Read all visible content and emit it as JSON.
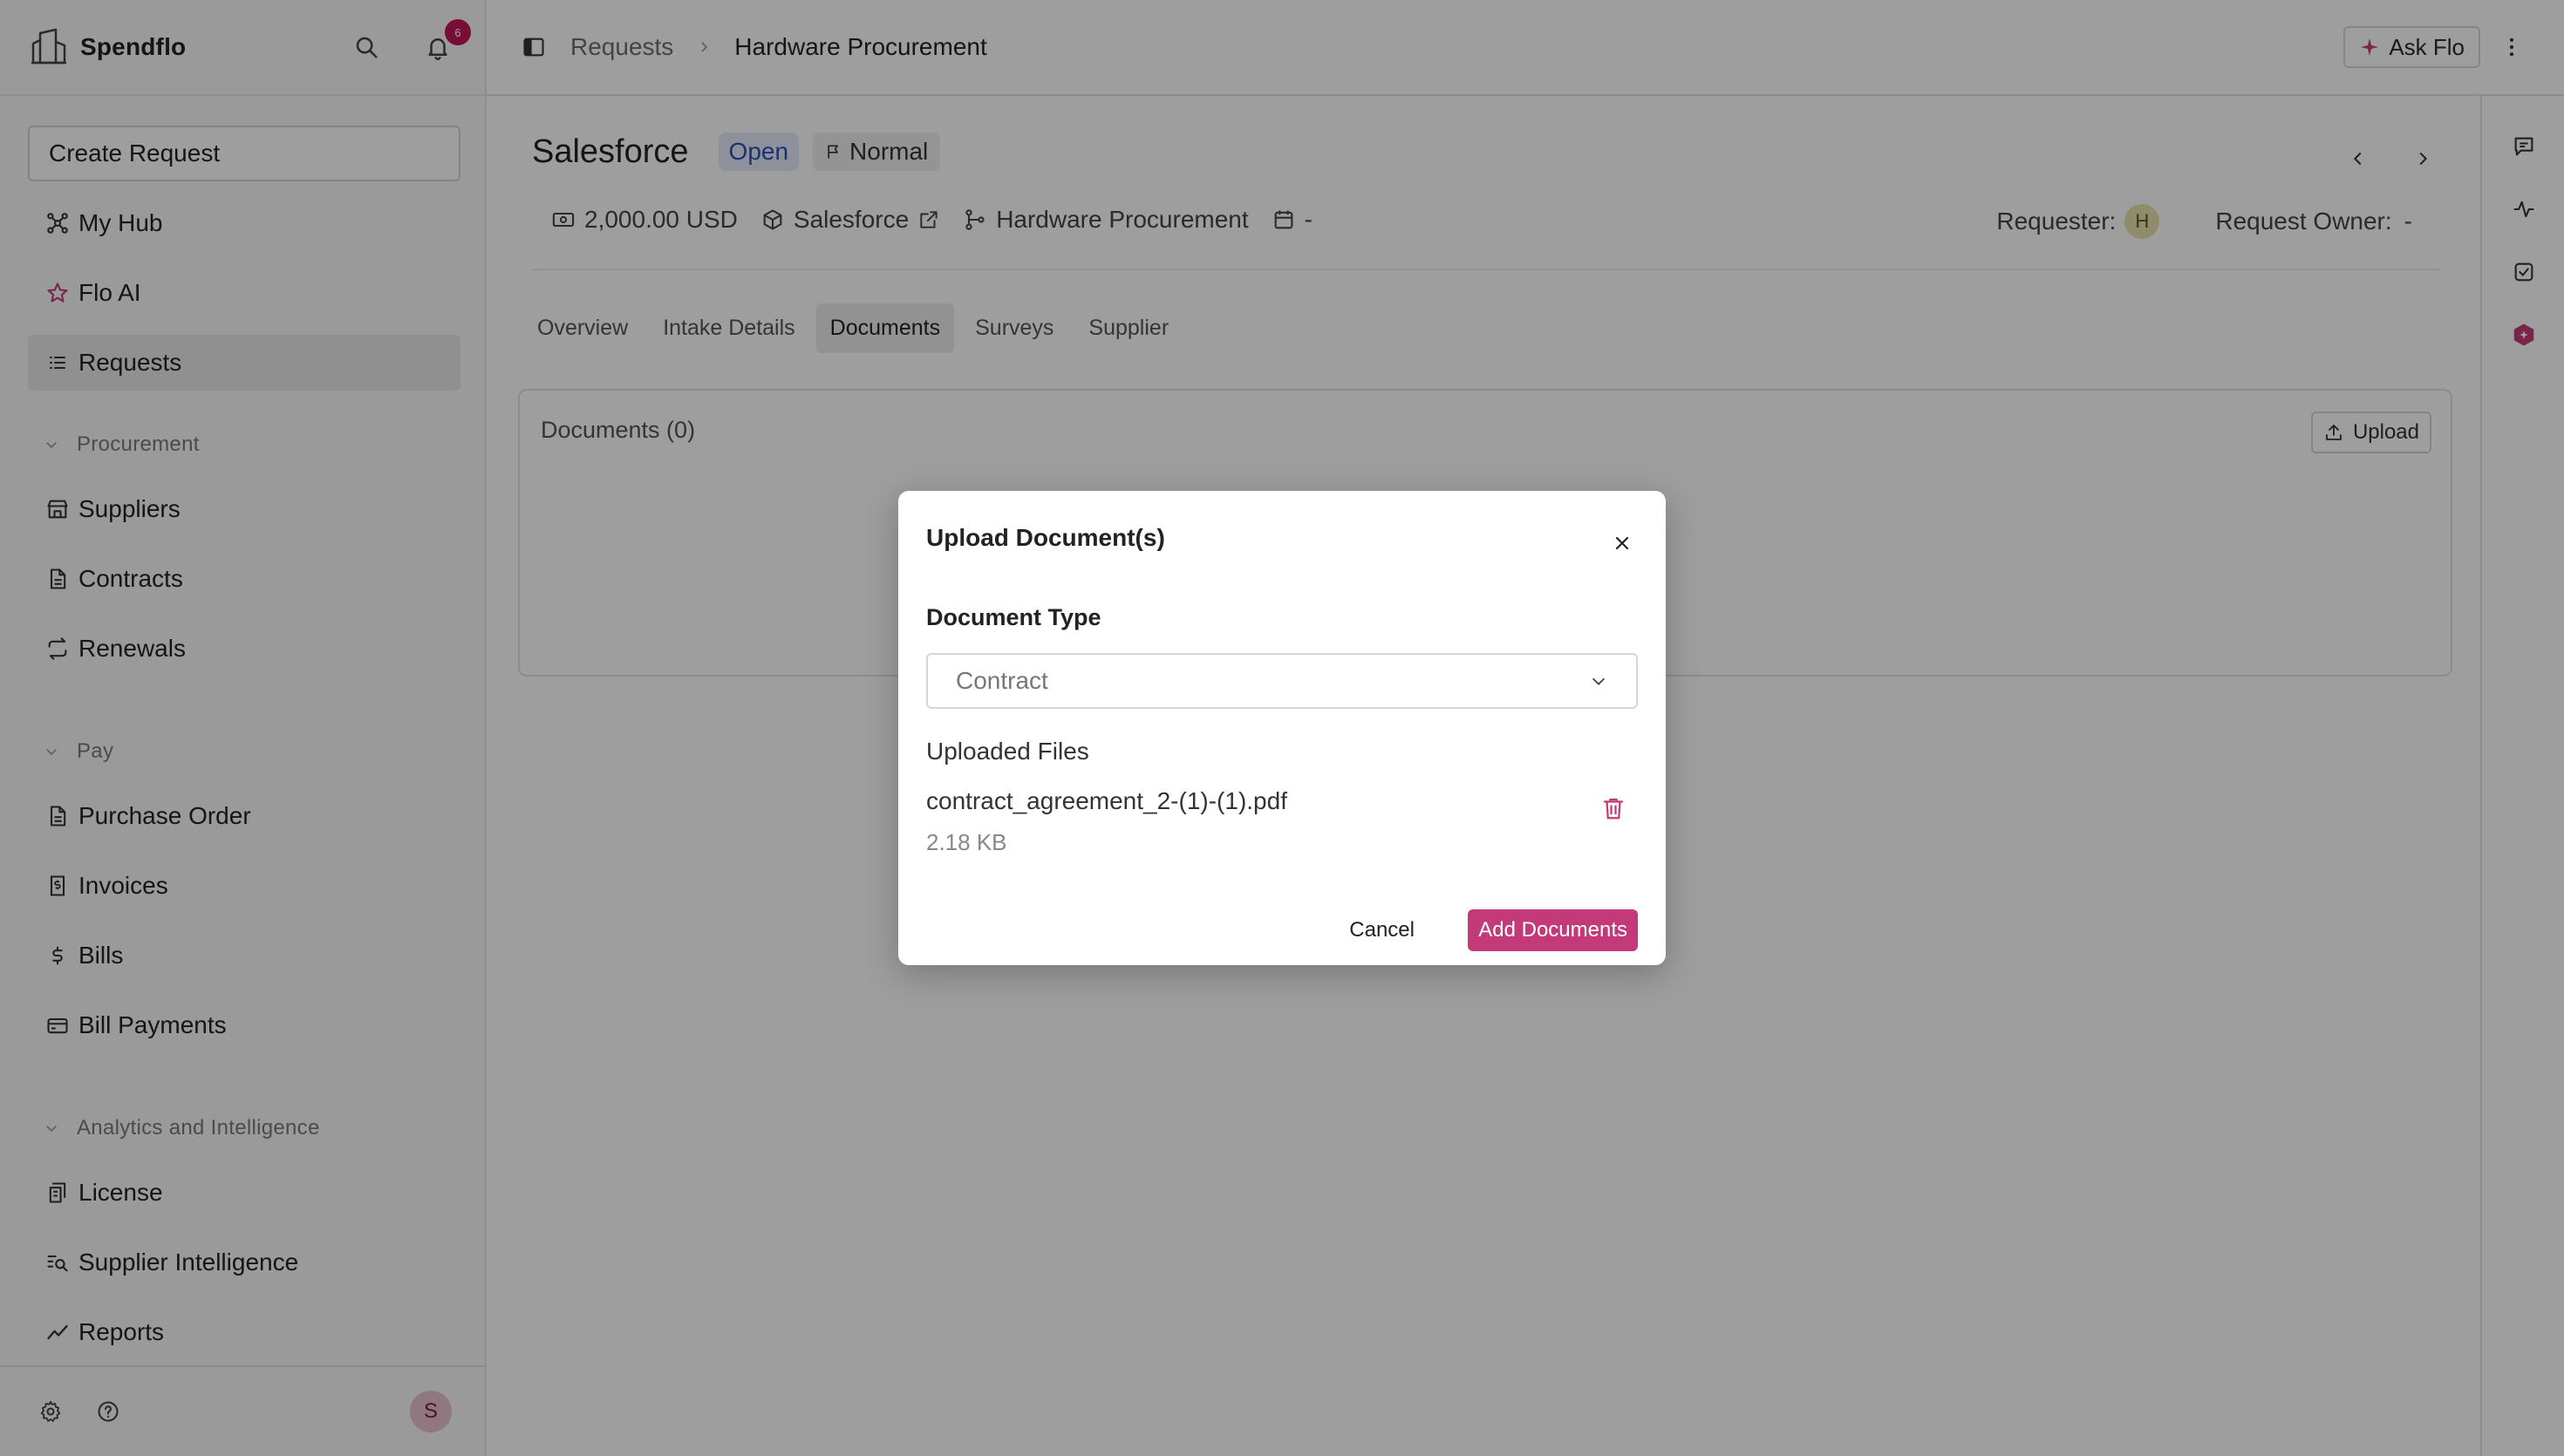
{
  "app": {
    "brand": "Spendflo",
    "notification_count": "6"
  },
  "sidebar": {
    "create_request": "Create Request",
    "top_items": [
      {
        "label": "My Hub",
        "icon": "hub-icon"
      },
      {
        "label": "Flo AI",
        "icon": "star-icon"
      },
      {
        "label": "Requests",
        "icon": "list-icon",
        "active": true
      }
    ],
    "sections": [
      {
        "title": "Procurement",
        "items": [
          {
            "label": "Suppliers",
            "icon": "store-icon"
          },
          {
            "label": "Contracts",
            "icon": "file-icon"
          },
          {
            "label": "Renewals",
            "icon": "refresh-icon"
          }
        ]
      },
      {
        "title": "Pay",
        "items": [
          {
            "label": "Purchase Order",
            "icon": "file-icon"
          },
          {
            "label": "Invoices",
            "icon": "invoice-icon"
          },
          {
            "label": "Bills",
            "icon": "dollar-icon"
          },
          {
            "label": "Bill Payments",
            "icon": "card-icon"
          }
        ]
      },
      {
        "title": "Analytics and Intelligence",
        "items": [
          {
            "label": "License",
            "icon": "license-icon"
          },
          {
            "label": "Supplier Intelligence",
            "icon": "search-list-icon"
          },
          {
            "label": "Reports",
            "icon": "chart-line-icon"
          }
        ]
      }
    ],
    "user_initial": "S"
  },
  "header": {
    "breadcrumb_root": "Requests",
    "breadcrumb_current": "Hardware Procurement",
    "ask_flo": "Ask Flo"
  },
  "request": {
    "title": "Salesforce",
    "status": "Open",
    "priority": "Normal",
    "amount": "2,000.00 USD",
    "supplier": "Salesforce",
    "workflow": "Hardware Procurement",
    "date": "-",
    "requester_label": "Requester:",
    "requester_initial": "H",
    "owner_label": "Request Owner:",
    "owner_value": "-"
  },
  "tabs": [
    {
      "label": "Overview"
    },
    {
      "label": "Intake Details"
    },
    {
      "label": "Documents",
      "active": true
    },
    {
      "label": "Surveys"
    },
    {
      "label": "Supplier"
    }
  ],
  "documents": {
    "title": "Documents (0)",
    "upload_label": "Upload"
  },
  "modal": {
    "title": "Upload Document(s)",
    "doc_type_label": "Document Type",
    "doc_type_value": "Contract",
    "uploaded_label": "Uploaded Files",
    "file_name": "contract_agreement_2-(1)-(1).pdf",
    "file_size": "2.18 KB",
    "cancel_label": "Cancel",
    "add_label": "Add Documents"
  },
  "colors": {
    "accent": "#c43a78",
    "open_badge_bg": "#e6ebfb",
    "open_badge_text": "#2c4fb8"
  }
}
